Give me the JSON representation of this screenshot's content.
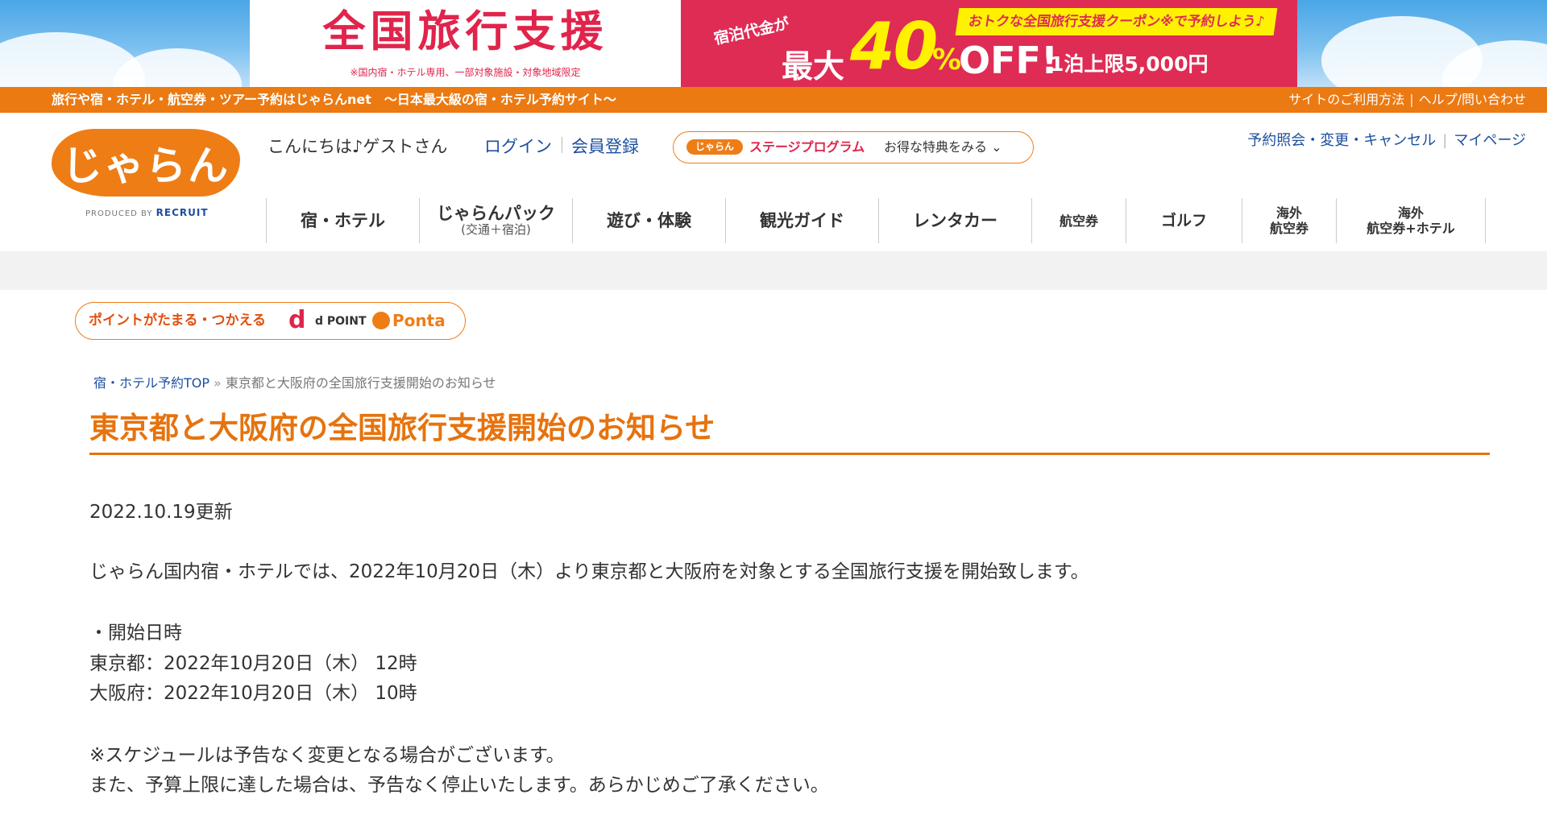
{
  "banner": {
    "title": "全国旅行支援",
    "note": "※国内宿・ホテル専用、一部対象施設・対象地域限定",
    "stay_price": "宿泊代金が",
    "max": "最大",
    "percent_number": "40",
    "percent_sign": "%",
    "off": "OFF!",
    "limit": "1泊上限5,000円",
    "coupon": "おトクな全国旅行支援クーポン※で予約しよう♪"
  },
  "strip": {
    "tagline": "旅行や宿・ホテル・航空券・ツアー予約はじゃらんnet　〜日本最大級の宿・ホテル予約サイト〜",
    "links": [
      "サイトのご利用方法",
      "ヘルプ/問い合わせ"
    ]
  },
  "header": {
    "logo": "じゃらん",
    "produced_by": "PRODUCED BY",
    "produced_brand": "RECRUIT",
    "greeting": "こんにちは♪ゲストさん",
    "login": "ログイン",
    "register": "会員登録",
    "stage_logo": "じゃらん",
    "stage_program": "ステージプログラム",
    "stage_link": "お得な特典をみる ⌄",
    "top_links": [
      "予約照会・変更・キャンセル",
      "マイページ"
    ]
  },
  "nav": {
    "items": [
      {
        "label": "宿・ホテル",
        "sub": ""
      },
      {
        "label": "じゃらんパック",
        "sub": "(交通＋宿泊)"
      },
      {
        "label": "遊び・体験",
        "sub": ""
      },
      {
        "label": "観光ガイド",
        "sub": ""
      },
      {
        "label": "レンタカー",
        "sub": ""
      },
      {
        "label": "航空券",
        "sub": ""
      },
      {
        "label": "ゴルフ",
        "sub": ""
      },
      {
        "label": "海外",
        "sub": "航空券"
      },
      {
        "label": "海外",
        "sub": "航空券+ホテル"
      }
    ]
  },
  "points": {
    "text": "ポイントがたまる・つかえる",
    "dpoint_mark": "d",
    "dpoint_label": "d POINT",
    "ponta": "Ponta"
  },
  "breadcrumb": {
    "home": "宿・ホテル予約TOP",
    "separator": "»",
    "current": "東京都と大阪府の全国旅行支援開始のお知らせ"
  },
  "article": {
    "title": "東京都と大阪府の全国旅行支援開始のお知らせ",
    "updated": "2022.10.19更新",
    "intro": "じゃらん国内宿・ホテルでは、2022年10月20日（木）より東京都と大阪府を対象とする全国旅行支援を開始致します。",
    "start_heading": "・開始日時",
    "tokyo": "東京都：2022年10月20日（木） 12時",
    "osaka": "大阪府：2022年10月20日（木） 10時",
    "note1": "※スケジュールは予告なく変更となる場合がございます。",
    "note2": "また、予算上限に達した場合は、予告なく停止いたします。あらかじめご了承ください。"
  }
}
